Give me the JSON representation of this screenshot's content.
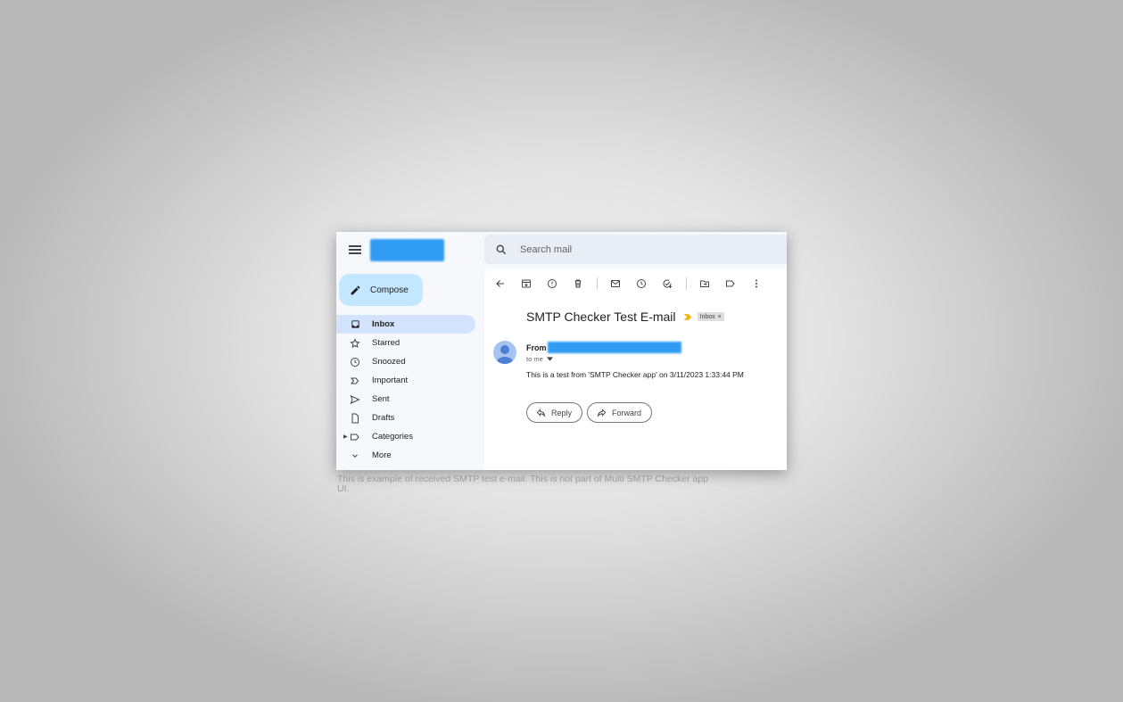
{
  "search": {
    "placeholder": "Search mail"
  },
  "compose": {
    "label": "Compose"
  },
  "nav": {
    "items": [
      {
        "label": "Inbox",
        "icon": "inbox-icon",
        "active": true
      },
      {
        "label": "Starred",
        "icon": "star-icon"
      },
      {
        "label": "Snoozed",
        "icon": "clock-icon"
      },
      {
        "label": "Important",
        "icon": "important-icon"
      },
      {
        "label": "Sent",
        "icon": "send-icon"
      },
      {
        "label": "Drafts",
        "icon": "draft-icon"
      },
      {
        "label": "Categories",
        "icon": "label-icon"
      },
      {
        "label": "More",
        "icon": "chevron-down-icon"
      }
    ]
  },
  "toolbar": {
    "icons": [
      "back-arrow-icon",
      "archive-icon",
      "report-spam-icon",
      "delete-icon",
      "mark-unread-icon",
      "snooze-icon",
      "add-task-icon",
      "move-to-icon",
      "label-icon",
      "more-vert-icon"
    ]
  },
  "email": {
    "subject": "SMTP Checker Test E-mail",
    "label_chip": "Inbox",
    "label_chip_close": "×",
    "from_label": "From",
    "to": "to me",
    "body": "This is a test from 'SMTP Checker app' on 3/11/2023 1:33:44 PM",
    "reply_label": "Reply",
    "forward_label": "Forward"
  },
  "caption": "This is example of received SMTP test e-mail. This is not part of Multi SMTP Checker app UI.",
  "colors": {
    "compose_bg": "#c2e7ff",
    "active_nav_bg": "#d3e3fd",
    "redaction_blue": "#2f9bf3",
    "important_marker": "#f4b400"
  }
}
